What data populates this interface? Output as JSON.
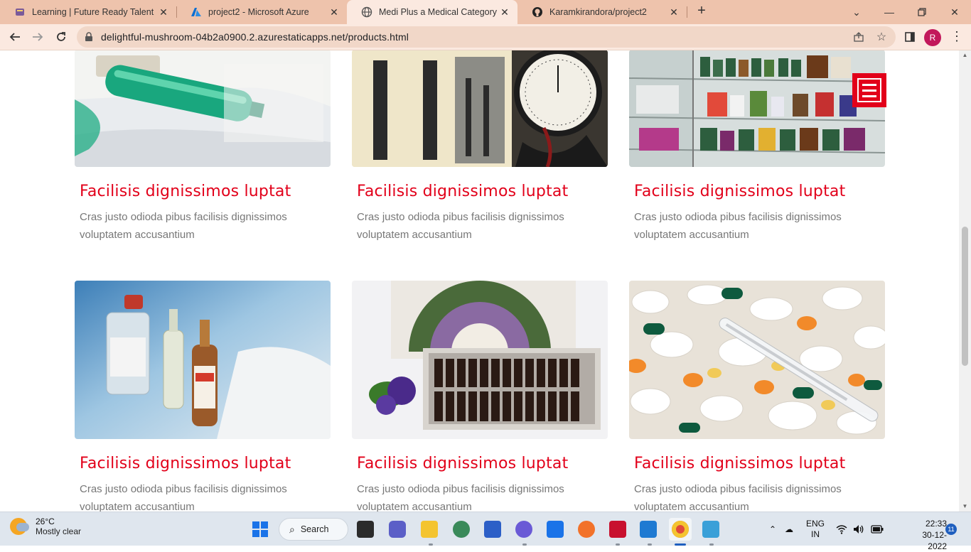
{
  "browser": {
    "tabs": [
      {
        "title": "Learning | Future Ready Talent",
        "icon": "graduation-icon"
      },
      {
        "title": "project2 - Microsoft Azure",
        "icon": "azure-icon"
      },
      {
        "title": "Medi Plus a Medical Category Fla",
        "icon": "globe-icon",
        "active": true
      },
      {
        "title": "Karamkirandora/project2",
        "icon": "github-icon"
      }
    ],
    "url": "delightful-mushroom-04b2a0900.2.azurestaticapps.net/products.html",
    "profile_initial": "R"
  },
  "page": {
    "accent_color": "#e2001a",
    "products": [
      {
        "title": "Facilisis dignissimos luptat",
        "desc": "Cras justo odioda pibus facilisis dignissimos voluptatem accusantium",
        "image": "syringe-image"
      },
      {
        "title": "Facilisis dignissimos luptat",
        "desc": "Cras justo odioda pibus facilisis dignissimos voluptatem accusantium",
        "image": "blood-pressure-gauge-image"
      },
      {
        "title": "Facilisis dignissimos luptat",
        "desc": "Cras justo odioda pibus facilisis dignissimos voluptatem accusantium",
        "image": "pharmacy-shelves-image"
      },
      {
        "title": "Facilisis dignissimos luptat",
        "desc": "Cras justo odioda pibus facilisis dignissimos voluptatem accusantium",
        "image": "vials-ampoules-image"
      },
      {
        "title": "Facilisis dignissimos luptat",
        "desc": "Cras justo odioda pibus facilisis dignissimos voluptatem accusantium",
        "image": "remedy-bottles-image"
      },
      {
        "title": "Facilisis dignissimos luptat",
        "desc": "Cras justo odioda pibus facilisis dignissimos voluptatem accusantium",
        "image": "pills-thermometer-image"
      }
    ]
  },
  "taskbar": {
    "weather_temp": "26°C",
    "weather_desc": "Mostly clear",
    "search_label": "Search",
    "lang_top": "ENG",
    "lang_bottom": "IN",
    "time": "22:33",
    "date": "30-12-2022",
    "notification_count": "11"
  }
}
